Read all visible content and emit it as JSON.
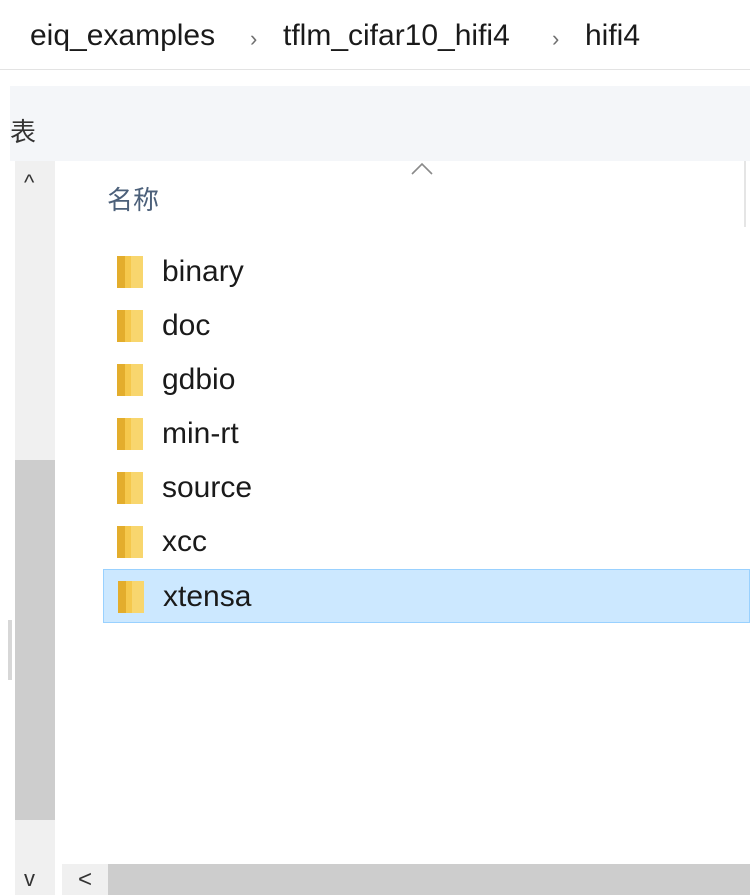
{
  "breadcrumb": {
    "items": [
      "eiq_examples",
      "tflm_cifar10_hifi4",
      "hifi4"
    ],
    "separator": "›"
  },
  "ribbon": {
    "partial_char": "表"
  },
  "columns": {
    "name_header": "名称",
    "sort_indicator": "up-caret"
  },
  "files": [
    {
      "name": "binary",
      "type": "folder",
      "selected": false
    },
    {
      "name": "doc",
      "type": "folder",
      "selected": false
    },
    {
      "name": "gdbio",
      "type": "folder",
      "selected": false
    },
    {
      "name": "min-rt",
      "type": "folder",
      "selected": false
    },
    {
      "name": "source",
      "type": "folder",
      "selected": false
    },
    {
      "name": "xcc",
      "type": "folder",
      "selected": false
    },
    {
      "name": "xtensa",
      "type": "folder",
      "selected": true
    }
  ],
  "nav_scrollbar": {
    "up": "^",
    "down": "v"
  },
  "h_scrollbar": {
    "left": "<"
  },
  "colors": {
    "selection_bg": "#cce8ff",
    "selection_border": "#99d1ff",
    "header_text": "#4c607a",
    "folder_yellow": "#f5c84c"
  },
  "icons": {
    "folder": "folder-icon",
    "sort": "sort-up-icon"
  }
}
